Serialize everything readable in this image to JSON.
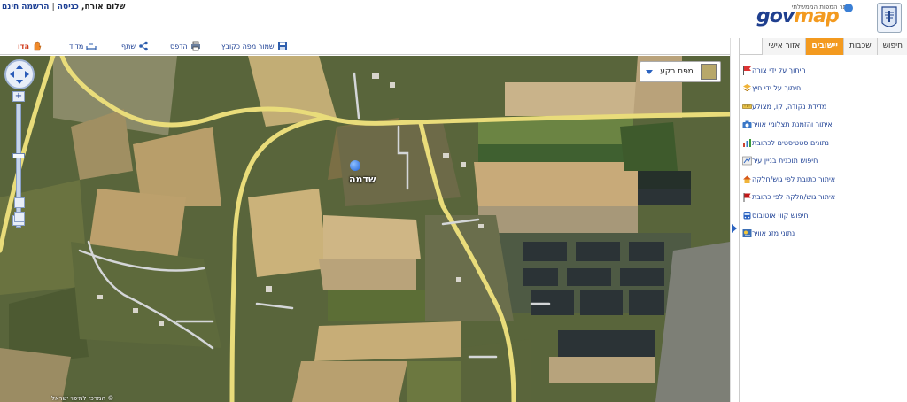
{
  "header": {
    "user_links": {
      "greeting": "שלום אורח,",
      "login": "כניסה",
      "separator": "|",
      "register": "הרשמה חינם"
    },
    "logo": {
      "subtitle": "אתר המפות הממשלתי",
      "brand_gov": "gov",
      "brand_map": "map"
    },
    "emblem_icon": "state-emblem-icon"
  },
  "toolbar": {
    "save": "שמור מפה כקובץ",
    "print": "הדפס",
    "share": "שתף",
    "measure": "מדוד",
    "help": "הדו"
  },
  "map": {
    "basemap_select": "מפת רקע",
    "place_label": "שדמה",
    "copyright": "© המרכז למיפוי ישראל",
    "scale_link": ""
  },
  "panel": {
    "tabs": [
      {
        "label": "חיפוש",
        "active": false
      },
      {
        "label": "שכבות",
        "active": false
      },
      {
        "label": "יישובים",
        "active": true
      },
      {
        "label": "אזור אישי",
        "active": false
      }
    ],
    "tools": [
      {
        "label": "חיתוך על ידי צורה",
        "icon": "flag-icon"
      },
      {
        "label": "חיתוך על ידי חיץ",
        "icon": "layers-icon"
      },
      {
        "label": "מדידת נקודה, קו, מצולע",
        "icon": "ruler-icon"
      },
      {
        "label": "איתור והזמנת תצלומי אוויר",
        "icon": "camera-icon"
      },
      {
        "label": "נתונים סטטיסטים לכתובת",
        "icon": "bar-chart-icon"
      },
      {
        "label": "חיפוש תוכנית בניין עיר",
        "icon": "plan-icon"
      },
      {
        "label": "איתור כתובת לפי גוש/חלקה",
        "icon": "house-icon"
      },
      {
        "label": "איתור גוש/חלקה לפי כתובת",
        "icon": "red-flag-icon"
      },
      {
        "label": "חיפוש קווי אוטובוס",
        "icon": "bus-icon"
      },
      {
        "label": "נתוני מזג אוויר",
        "icon": "weather-icon"
      }
    ]
  },
  "colors": {
    "brand_blue": "#1f3f8f",
    "brand_orange": "#f39a1f",
    "link_blue": "#1c3f94",
    "road_yellow": "#e9dc7a"
  }
}
